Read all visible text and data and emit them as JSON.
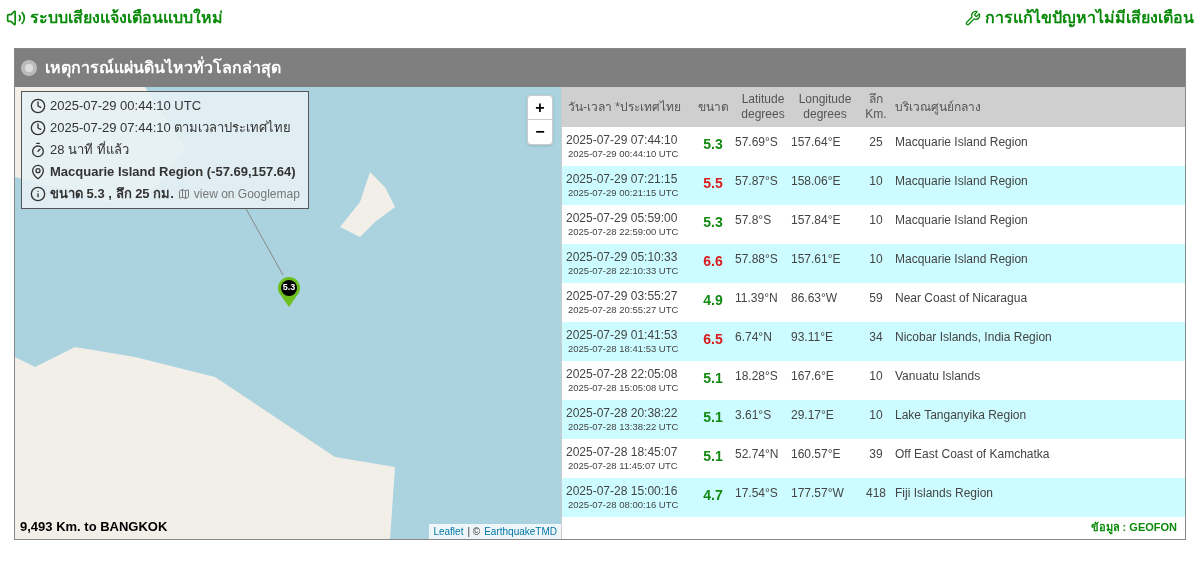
{
  "top_links": {
    "left": "ระบบเสียงแจ้งเตือนแบบใหม่",
    "right": "การแก้ไขปัญหาไม่มีเสียงเตือน"
  },
  "panel": {
    "title": "เหตุการณ์แผ่นดินไหวทั่วโลกล่าสุด"
  },
  "map": {
    "info": {
      "utc": "2025-07-29 00:44:10 UTC",
      "local": "2025-07-29 07:44:10 ตามเวลาประเทศไทย",
      "ago": "28 นาที ที่แล้ว",
      "place": "Macquarie Island Region (-57.69,157.64)",
      "size": "ขนาด 5.3 , ลึก 25 กม.",
      "map_link": "view on Googlemap"
    },
    "zoom_in": "+",
    "zoom_out": "−",
    "marker": "5.3",
    "distance": "9,493 Km. to BANGKOK",
    "attribution": {
      "leaflet": "Leaflet",
      "sep": "| ©",
      "source": "EarthquakeTMD"
    }
  },
  "table": {
    "columns": [
      "วัน-เวลา *ประเทศไทย",
      "ขนาด",
      "Latitude degrees",
      "Longitude degrees",
      "ลึก Km.",
      "บริเวณศูนย์กลาง"
    ],
    "rows": [
      {
        "local": "2025-07-29 07:44:10",
        "utc": "2025-07-29 00:44:10 UTC",
        "mag": "5.3",
        "color": "#128a12",
        "lat": "57.69°S",
        "lon": "157.64°E",
        "depth": "25",
        "region": "Macquarie Island Region"
      },
      {
        "local": "2025-07-29 07:21:15",
        "utc": "2025-07-29 00:21:15 UTC",
        "mag": "5.5",
        "color": "#d81c1c",
        "lat": "57.87°S",
        "lon": "158.06°E",
        "depth": "10",
        "region": "Macquarie Island Region"
      },
      {
        "local": "2025-07-29 05:59:00",
        "utc": "2025-07-28 22:59:00 UTC",
        "mag": "5.3",
        "color": "#128a12",
        "lat": "57.8°S",
        "lon": "157.84°E",
        "depth": "10",
        "region": "Macquarie Island Region"
      },
      {
        "local": "2025-07-29 05:10:33",
        "utc": "2025-07-28 22:10:33 UTC",
        "mag": "6.6",
        "color": "#d81c1c",
        "lat": "57.88°S",
        "lon": "157.61°E",
        "depth": "10",
        "region": "Macquarie Island Region"
      },
      {
        "local": "2025-07-29 03:55:27",
        "utc": "2025-07-28 20:55:27 UTC",
        "mag": "4.9",
        "color": "#128a12",
        "lat": "11.39°N",
        "lon": "86.63°W",
        "depth": "59",
        "region": "Near Coast of Nicaragua"
      },
      {
        "local": "2025-07-29 01:41:53",
        "utc": "2025-07-28 18:41:53 UTC",
        "mag": "6.5",
        "color": "#d81c1c",
        "lat": "6.74°N",
        "lon": "93.11°E",
        "depth": "34",
        "region": "Nicobar Islands, India Region"
      },
      {
        "local": "2025-07-28 22:05:08",
        "utc": "2025-07-28 15:05:08 UTC",
        "mag": "5.1",
        "color": "#128a12",
        "lat": "18.28°S",
        "lon": "167.6°E",
        "depth": "10",
        "region": "Vanuatu Islands"
      },
      {
        "local": "2025-07-28 20:38:22",
        "utc": "2025-07-28 13:38:22 UTC",
        "mag": "5.1",
        "color": "#128a12",
        "lat": "3.61°S",
        "lon": "29.17°E",
        "depth": "10",
        "region": "Lake Tanganyika Region"
      },
      {
        "local": "2025-07-28 18:45:07",
        "utc": "2025-07-28 11:45:07 UTC",
        "mag": "5.1",
        "color": "#128a12",
        "lat": "52.74°N",
        "lon": "160.57°E",
        "depth": "39",
        "region": "Off East Coast of Kamchatka"
      },
      {
        "local": "2025-07-28 15:00:16",
        "utc": "2025-07-28 08:00:16 UTC",
        "mag": "4.7",
        "color": "#128a12",
        "lat": "17.54°S",
        "lon": "177.57°W",
        "depth": "418",
        "region": "Fiji Islands Region"
      }
    ],
    "source": "ข้อมูล : GEOFON"
  }
}
